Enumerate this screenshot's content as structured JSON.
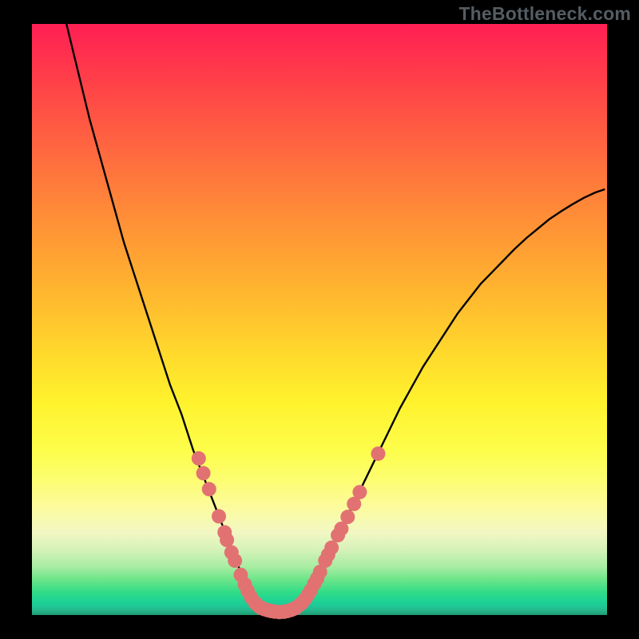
{
  "watermark": "TheBottleneck.com",
  "chart_data": {
    "type": "line",
    "title": "",
    "xlabel": "",
    "ylabel": "",
    "xlim": [
      0,
      100
    ],
    "ylim": [
      0,
      100
    ],
    "series": [
      {
        "name": "curve-left",
        "x": [
          6,
          8,
          10,
          12,
          14,
          16,
          18,
          20,
          22,
          24,
          26,
          27,
          28,
          29,
          30,
          31,
          32,
          33,
          34,
          35,
          36,
          37,
          38,
          39,
          40,
          41,
          42,
          43
        ],
        "values": [
          100,
          92,
          84,
          77,
          70,
          63,
          57,
          51,
          45,
          39,
          34,
          31,
          28,
          25.5,
          23,
          20.5,
          18,
          15.5,
          13,
          10.5,
          8,
          5.5,
          3.4,
          2.1,
          1.3,
          0.85,
          0.6,
          0.5
        ]
      },
      {
        "name": "curve-right",
        "x": [
          43,
          44,
          45,
          46,
          47,
          48,
          49,
          50,
          52,
          54,
          56,
          58,
          60,
          62,
          64,
          66,
          68,
          70,
          72,
          74,
          76,
          78,
          80,
          82,
          84,
          86,
          88,
          90,
          92,
          94,
          96,
          98,
          99.5
        ],
        "values": [
          0.5,
          0.6,
          0.85,
          1.3,
          2.1,
          3.4,
          5.2,
          7.2,
          11,
          15,
          19,
          23,
          27,
          31,
          35,
          38.5,
          42,
          45,
          48,
          51,
          53.5,
          56,
          58,
          60,
          62,
          63.8,
          65.4,
          67,
          68.3,
          69.5,
          70.6,
          71.5,
          72
        ]
      }
    ],
    "markers": {
      "name": "highlighted-points",
      "color": "#e27272",
      "points": [
        {
          "x": 29.0,
          "y": 26.5
        },
        {
          "x": 29.8,
          "y": 24.0
        },
        {
          "x": 30.8,
          "y": 21.3
        },
        {
          "x": 32.5,
          "y": 16.7
        },
        {
          "x": 33.5,
          "y": 14.0
        },
        {
          "x": 33.9,
          "y": 12.7
        },
        {
          "x": 34.7,
          "y": 10.6
        },
        {
          "x": 35.3,
          "y": 9.2
        },
        {
          "x": 36.3,
          "y": 6.8
        },
        {
          "x": 37.0,
          "y": 5.2
        },
        {
          "x": 37.5,
          "y": 4.1
        },
        {
          "x": 38.1,
          "y": 3.0
        },
        {
          "x": 38.8,
          "y": 2.1
        },
        {
          "x": 39.3,
          "y": 1.6
        },
        {
          "x": 39.8,
          "y": 1.25
        },
        {
          "x": 40.4,
          "y": 1.0
        },
        {
          "x": 41.0,
          "y": 0.82
        },
        {
          "x": 41.6,
          "y": 0.68
        },
        {
          "x": 42.2,
          "y": 0.58
        },
        {
          "x": 43.0,
          "y": 0.5
        },
        {
          "x": 43.8,
          "y": 0.55
        },
        {
          "x": 44.4,
          "y": 0.68
        },
        {
          "x": 45.0,
          "y": 0.85
        },
        {
          "x": 45.4,
          "y": 1.0
        },
        {
          "x": 45.9,
          "y": 1.22
        },
        {
          "x": 46.5,
          "y": 1.7
        },
        {
          "x": 47.0,
          "y": 2.1
        },
        {
          "x": 47.5,
          "y": 2.7
        },
        {
          "x": 48.0,
          "y": 3.4
        },
        {
          "x": 48.5,
          "y": 4.2
        },
        {
          "x": 49.1,
          "y": 5.3
        },
        {
          "x": 49.6,
          "y": 6.2
        },
        {
          "x": 50.1,
          "y": 7.3
        },
        {
          "x": 51.0,
          "y": 9.2
        },
        {
          "x": 51.5,
          "y": 10.2
        },
        {
          "x": 52.1,
          "y": 11.4
        },
        {
          "x": 53.2,
          "y": 13.5
        },
        {
          "x": 53.8,
          "y": 14.6
        },
        {
          "x": 54.9,
          "y": 16.6
        },
        {
          "x": 56.0,
          "y": 18.8
        },
        {
          "x": 57.0,
          "y": 20.8
        },
        {
          "x": 60.2,
          "y": 27.3
        }
      ]
    }
  }
}
